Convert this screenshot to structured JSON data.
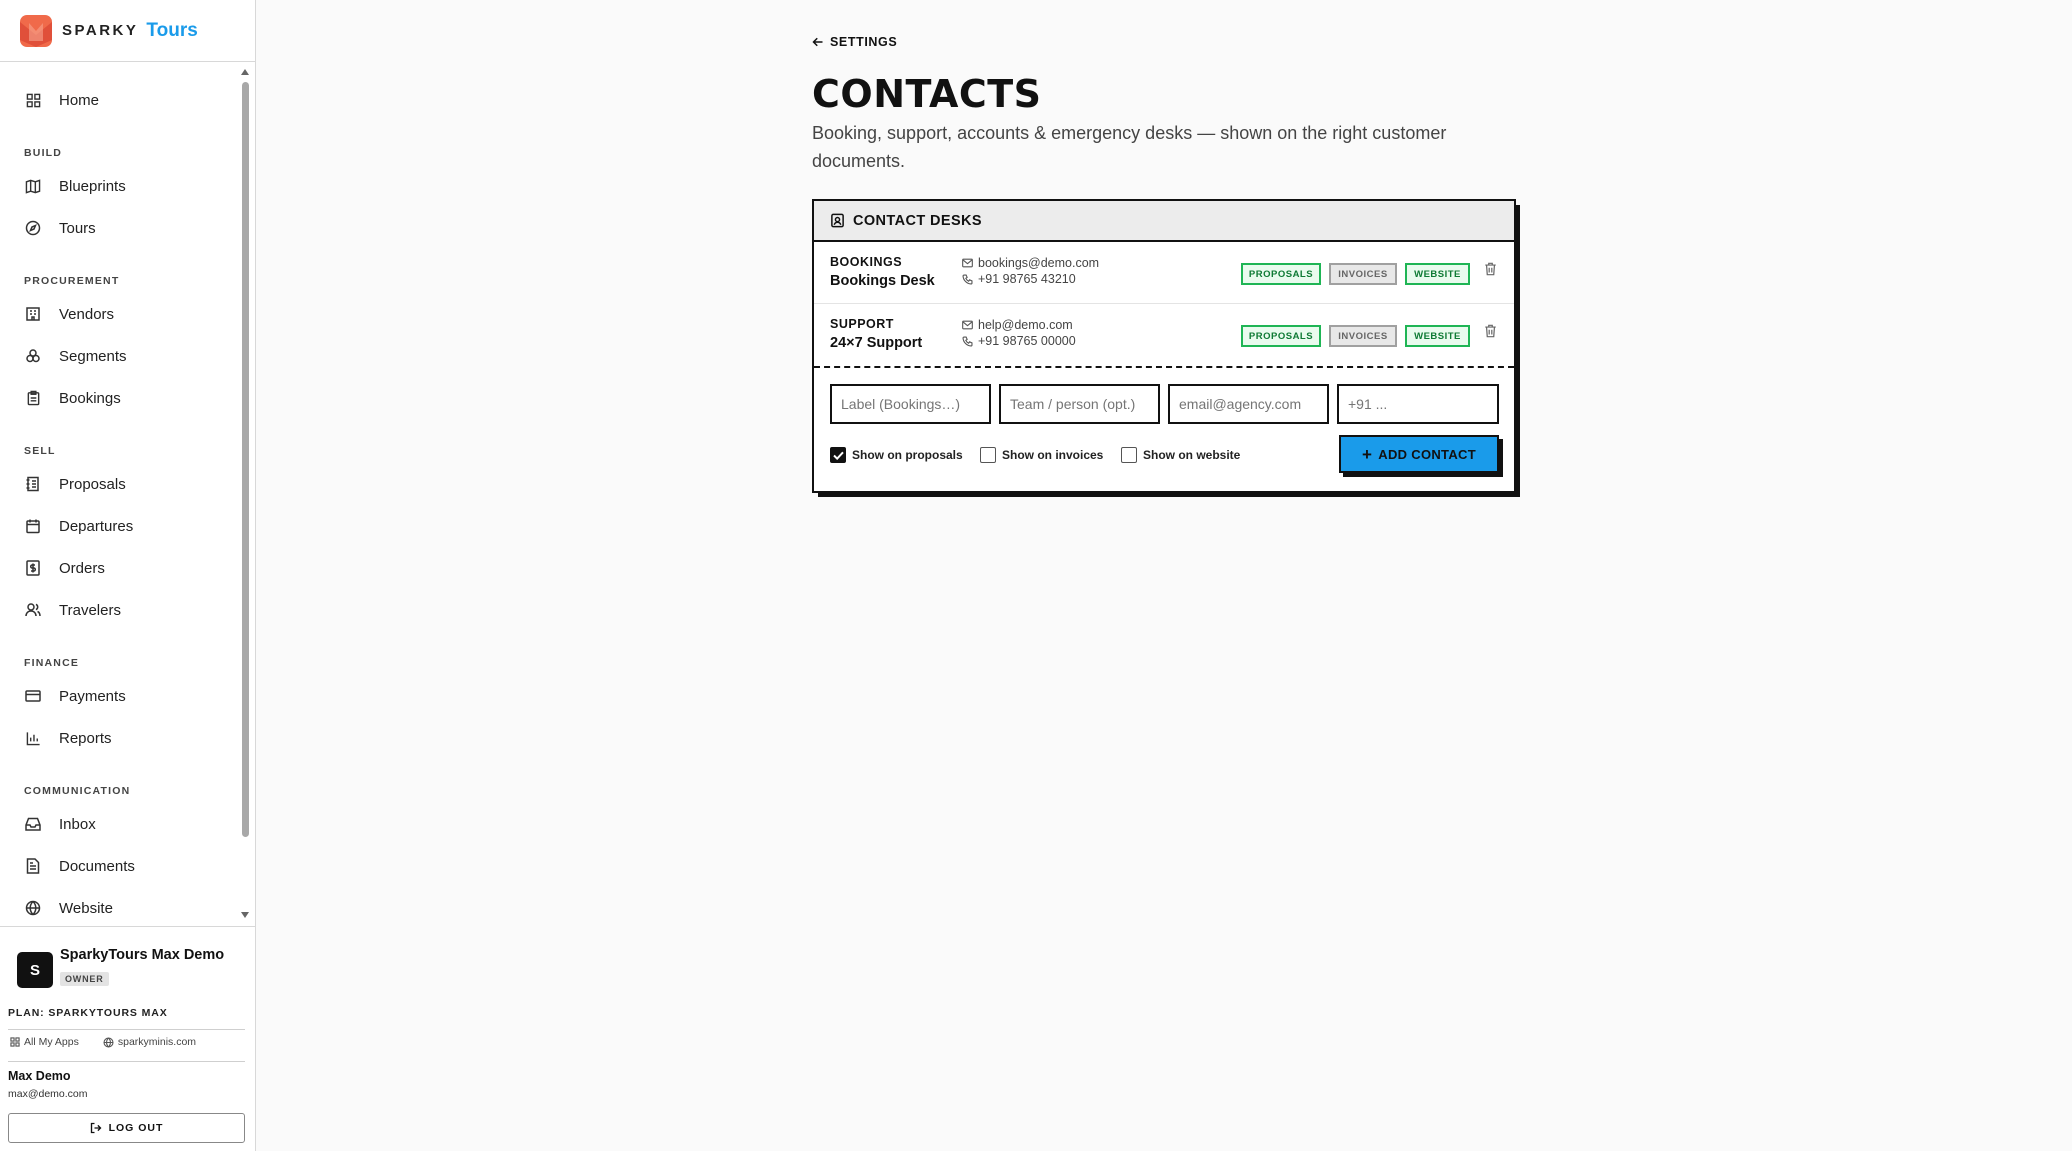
{
  "brand": {
    "sparky": "SPARKY",
    "tours": "Tours"
  },
  "nav": {
    "home": "Home",
    "sections": {
      "build": "BUILD",
      "procurement": "PROCUREMENT",
      "sell": "SELL",
      "finance": "FINANCE",
      "communication": "COMMUNICATION"
    },
    "items": {
      "blueprints": "Blueprints",
      "tours": "Tours",
      "vendors": "Vendors",
      "segments": "Segments",
      "bookings": "Bookings",
      "proposals": "Proposals",
      "departures": "Departures",
      "orders": "Orders",
      "travelers": "Travelers",
      "payments": "Payments",
      "reports": "Reports",
      "inbox": "Inbox",
      "documents": "Documents",
      "website": "Website"
    }
  },
  "account": {
    "avatar_letter": "S",
    "org_name": "SparkyTours Max Demo",
    "role": "OWNER",
    "plan": "PLAN: SPARKYTOURS MAX",
    "all_apps": "All My Apps",
    "site": "sparkyminis.com",
    "user_name": "Max Demo",
    "user_email": "max@demo.com",
    "logout": "LOG OUT"
  },
  "page": {
    "back": "SETTINGS",
    "title": "CONTACTS",
    "subtitle": "Booking, support, accounts & emergency desks — shown on the right customer documents."
  },
  "card": {
    "title": "CONTACT DESKS",
    "contacts": [
      {
        "label": "BOOKINGS",
        "name": "Bookings Desk",
        "email": "bookings@demo.com",
        "phone": "+91 98765 43210",
        "badges": {
          "proposals": "PROPOSALS",
          "invoices": "INVOICES",
          "website": "WEBSITE"
        },
        "badge_state": {
          "proposals": true,
          "invoices": false,
          "website": true
        }
      },
      {
        "label": "SUPPORT",
        "name": "24×7 Support",
        "email": "help@demo.com",
        "phone": "+91 98765 00000",
        "badges": {
          "proposals": "PROPOSALS",
          "invoices": "INVOICES",
          "website": "WEBSITE"
        },
        "badge_state": {
          "proposals": true,
          "invoices": false,
          "website": true
        }
      }
    ],
    "form": {
      "label_placeholder": "Label (Bookings…)",
      "team_placeholder": "Team / person (opt.)",
      "email_placeholder": "email@agency.com",
      "phone_placeholder": "+91 ...",
      "show_proposals": "Show on proposals",
      "show_proposals_checked": true,
      "show_invoices": "Show on invoices",
      "show_invoices_checked": false,
      "show_website": "Show on website",
      "show_website_checked": false,
      "add_button": "ADD CONTACT"
    }
  }
}
